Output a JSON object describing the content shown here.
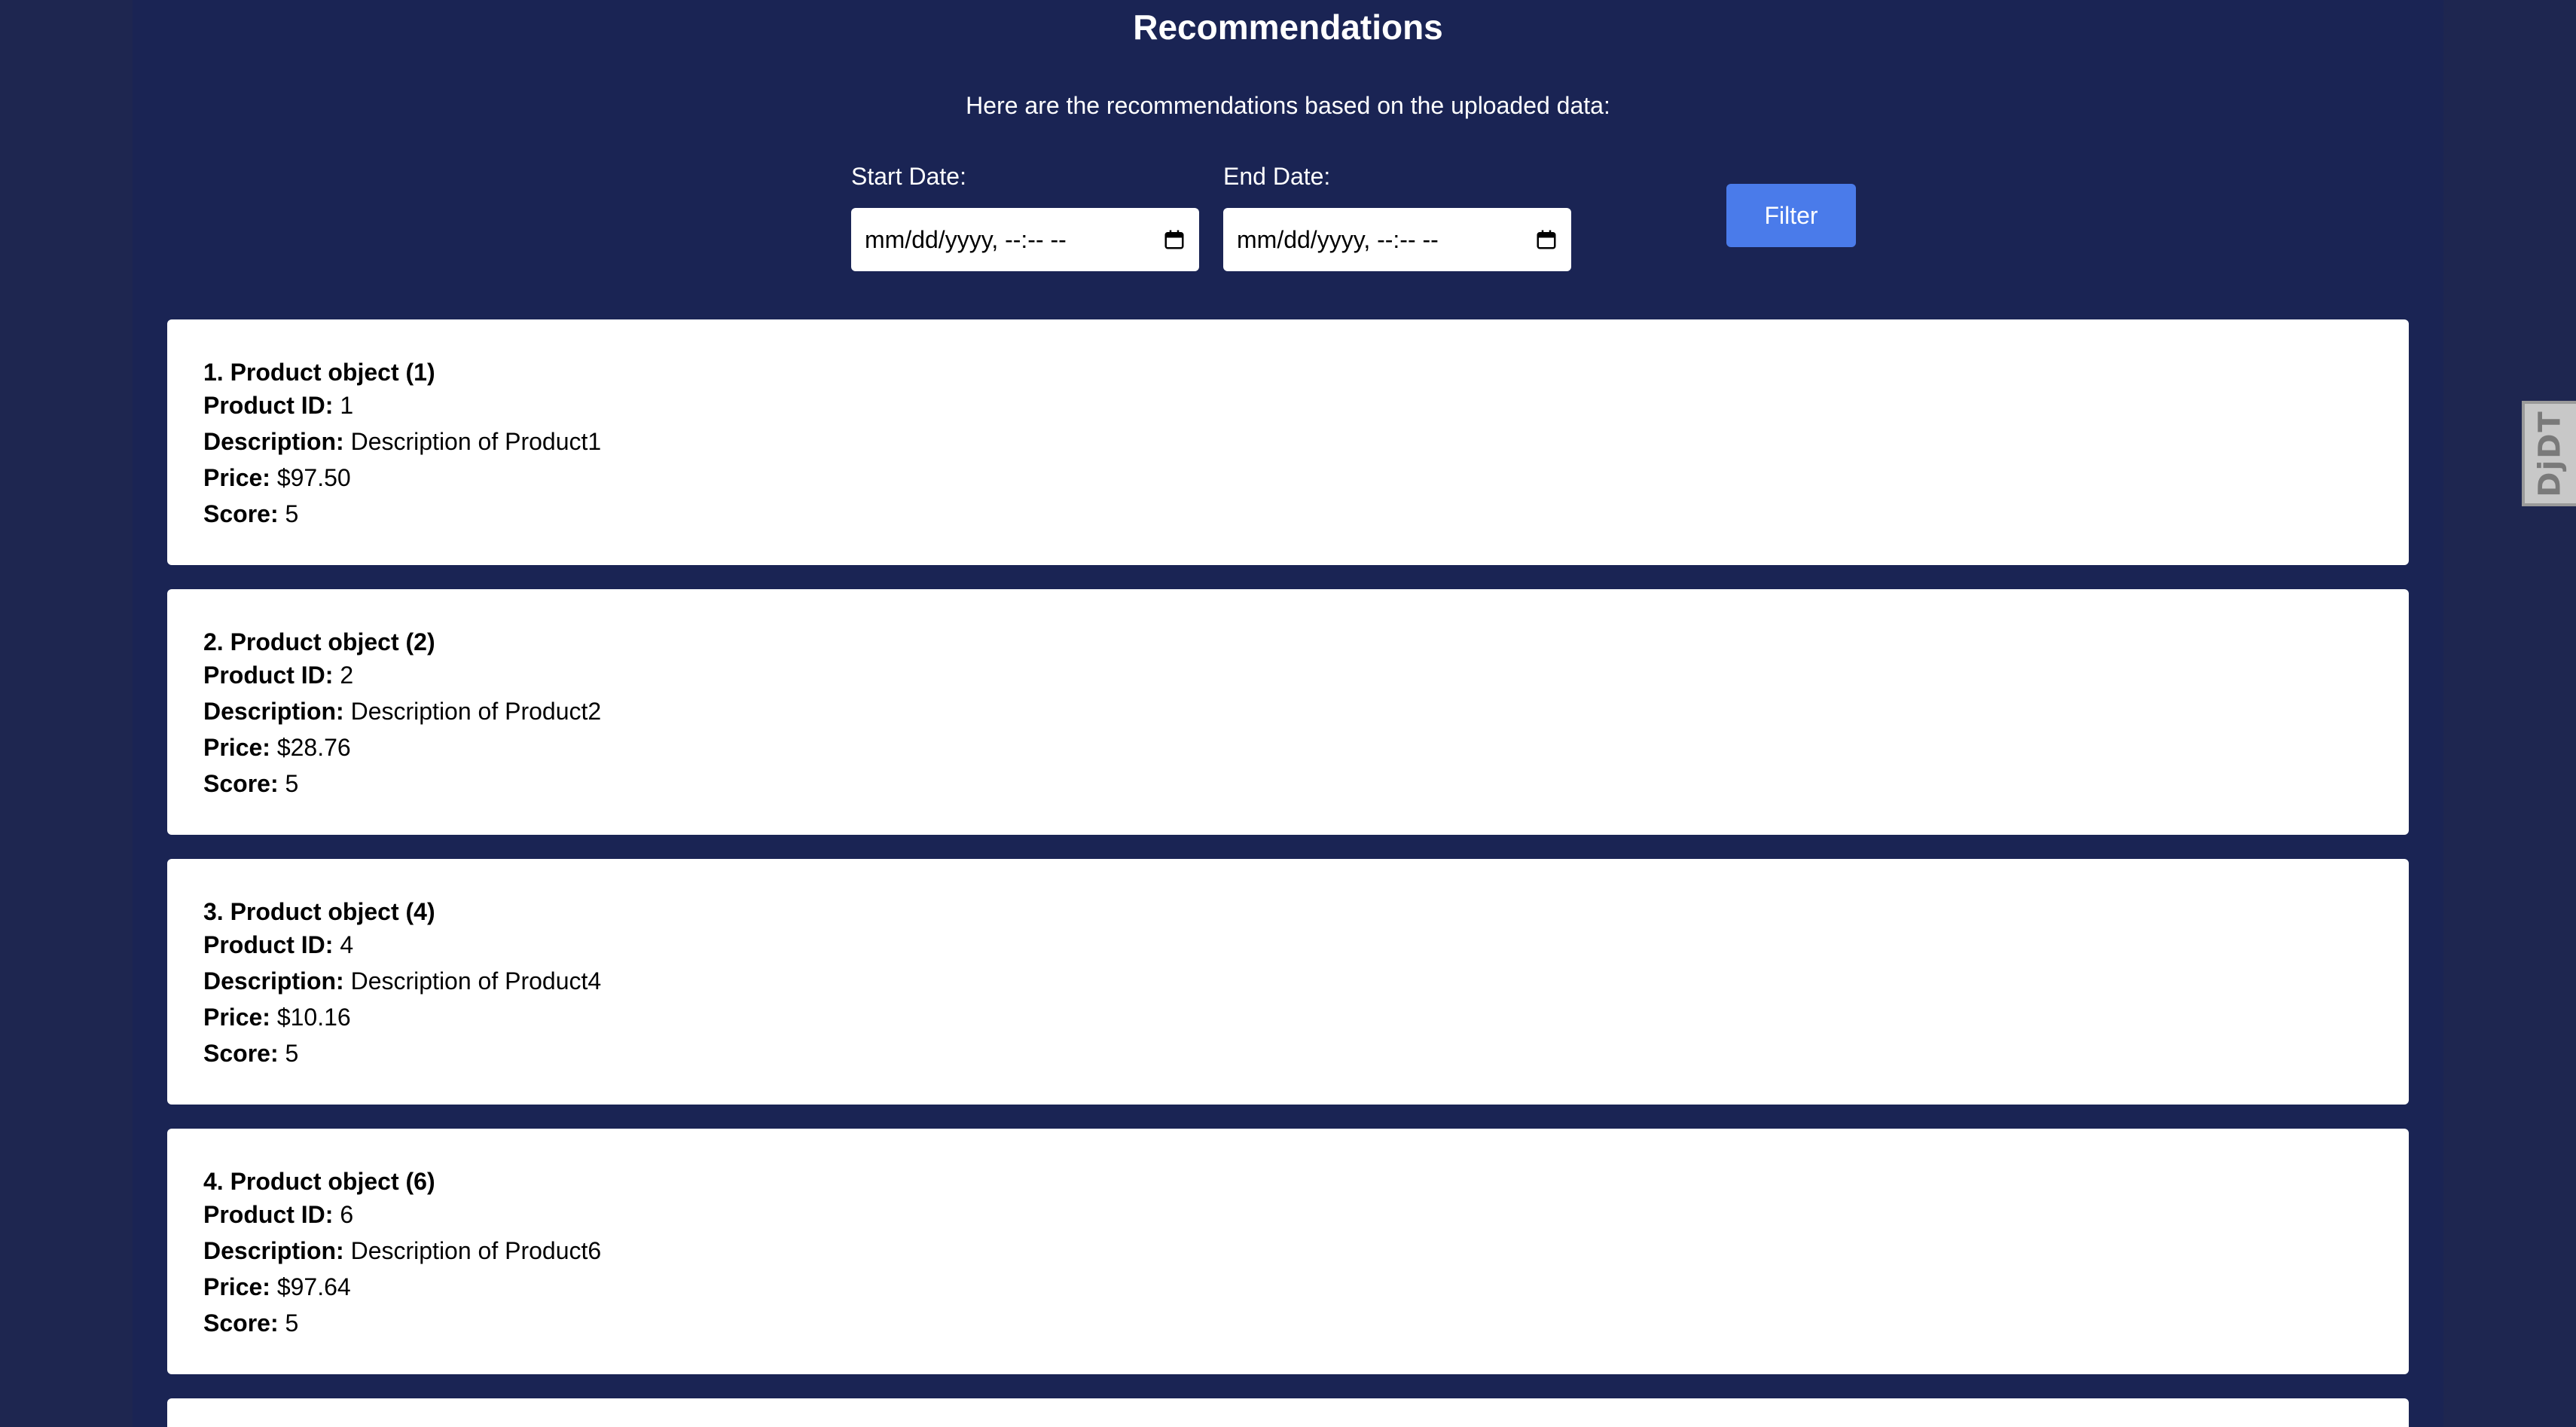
{
  "page": {
    "title": "Recommendations",
    "subtitle": "Here are the recommendations based on the uploaded data:"
  },
  "filter": {
    "start_label": "Start Date:",
    "start_value": "mm/dd/yyyy, --:-- --",
    "end_label": "End Date:",
    "end_value": "mm/dd/yyyy, --:-- --",
    "button_label": "Filter"
  },
  "field_labels": {
    "product_id": "Product ID:",
    "description": "Description:",
    "price": "Price:",
    "score": "Score:"
  },
  "products": [
    {
      "title": "1. Product object (1)",
      "id": "1",
      "description": "Description of Product1",
      "price": "$97.50",
      "score": "5"
    },
    {
      "title": "2. Product object (2)",
      "id": "2",
      "description": "Description of Product2",
      "price": "$28.76",
      "score": "5"
    },
    {
      "title": "3. Product object (4)",
      "id": "4",
      "description": "Description of Product4",
      "price": "$10.16",
      "score": "5"
    },
    {
      "title": "4. Product object (6)",
      "id": "6",
      "description": "Description of Product6",
      "price": "$97.64",
      "score": "5"
    }
  ],
  "debug_toolbar": {
    "label": "DjDT"
  },
  "colors": {
    "background": "#1a2454",
    "button": "#4a7bea",
    "card": "#ffffff"
  }
}
